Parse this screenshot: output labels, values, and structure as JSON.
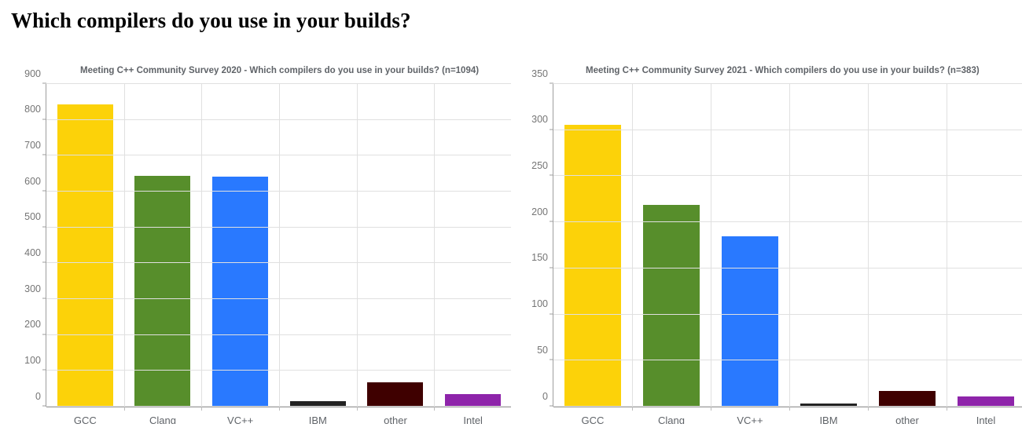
{
  "page": {
    "title": "Which compilers do you use in your builds?"
  },
  "chart_data": [
    {
      "id": "chart-2020",
      "type": "bar",
      "title": "Meeting C++ Community Survey 2020 - Which compilers do you use in your builds? (n=1094)",
      "xlabel": "",
      "ylabel": "",
      "categories": [
        "GCC",
        "Clang",
        "VC++",
        "IBM",
        "other",
        "Intel"
      ],
      "values": [
        844,
        644,
        642,
        15,
        67,
        35
      ],
      "colors": [
        "#FCD209",
        "#578E2B",
        "#2979FF",
        "#222222",
        "#3F0000",
        "#8E24AA"
      ],
      "ylim": [
        0,
        900
      ],
      "yticks": [
        0,
        100,
        200,
        300,
        400,
        500,
        600,
        700,
        800,
        900
      ],
      "ytick_labels": [
        "0",
        "100",
        "200",
        "300",
        "400",
        "500",
        "600",
        "700",
        "800",
        "900"
      ],
      "grid": true,
      "legend": "none",
      "respondents": 1094,
      "survey_year": 2020
    },
    {
      "id": "chart-2021",
      "type": "bar",
      "title": "Meeting C++ Community Survey 2021  - Which compilers do you use in your builds? (n=383)",
      "xlabel": "",
      "ylabel": "",
      "categories": [
        "GCC",
        "Clang",
        "VC++",
        "IBM",
        "other",
        "Intel"
      ],
      "values": [
        306,
        219,
        185,
        3,
        17,
        11
      ],
      "colors": [
        "#FCD209",
        "#578E2B",
        "#2979FF",
        "#222222",
        "#3F0000",
        "#8E24AA"
      ],
      "ylim": [
        0,
        350
      ],
      "yticks": [
        0,
        50,
        100,
        150,
        200,
        250,
        300,
        350
      ],
      "ytick_labels": [
        "0",
        "50",
        "100",
        "150",
        "200",
        "250",
        "300",
        "350"
      ],
      "grid": true,
      "legend": "none",
      "respondents": 383,
      "survey_year": 2021
    }
  ]
}
